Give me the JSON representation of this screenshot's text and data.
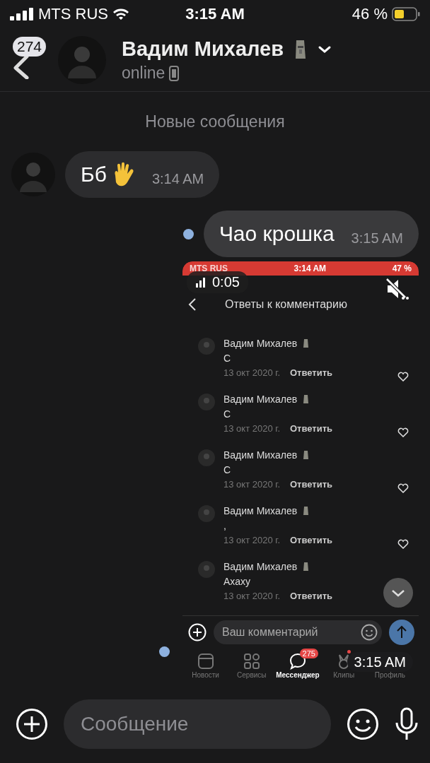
{
  "status_bar": {
    "carrier": "MTS RUS",
    "time": "3:15 AM",
    "battery": "46 %"
  },
  "header": {
    "back_count": "274",
    "name": "Вадим Михалев",
    "status": "online"
  },
  "divider": "Новые сообщения",
  "messages": [
    {
      "kind": "text",
      "incoming": true,
      "unread": false,
      "text": "Бб",
      "time": "3:14 AM"
    },
    {
      "kind": "text",
      "incoming": false,
      "unread": true,
      "text": "Чао крошка",
      "time": "3:15 AM"
    },
    {
      "kind": "video",
      "incoming": false,
      "unread": true,
      "duration": "0:05",
      "time": "3:15 AM",
      "muted": true
    }
  ],
  "video_screen": {
    "status_bar": {
      "carrier": "MTS RUS",
      "time": "3:14 AM",
      "battery": "47 %"
    },
    "title": "Ответы к комментарию",
    "comments": [
      {
        "author": "Вадим Михалев",
        "text": "С",
        "date": "13 окт 2020 г.",
        "reply": "Ответить"
      },
      {
        "author": "Вадим Михалев",
        "text": "С",
        "date": "13 окт 2020 г.",
        "reply": "Ответить"
      },
      {
        "author": "Вадим Михалев",
        "text": "С",
        "date": "13 окт 2020 г.",
        "reply": "Ответить"
      },
      {
        "author": "Вадим Михалев",
        "text": ",",
        "date": "13 окт 2020 г.",
        "reply": "Ответить"
      },
      {
        "author": "Вадим Михалев",
        "text": "Ахаху",
        "date": "13 окт 2020 г.",
        "reply": "Ответить"
      }
    ],
    "composer": {
      "placeholder": "Ваш комментарий"
    },
    "tabs": [
      {
        "kind": "news",
        "label": "Новости",
        "selected": false,
        "notification": false
      },
      {
        "kind": "services",
        "label": "Сервисы",
        "selected": false,
        "notification": false
      },
      {
        "kind": "messenger",
        "label": "Мессенджер",
        "selected": true,
        "notification": false,
        "badge": "275"
      },
      {
        "kind": "clips",
        "label": "Клипы",
        "selected": false,
        "notification": true
      },
      {
        "kind": "profile",
        "label": "Профиль",
        "selected": false,
        "notification": false
      }
    ]
  },
  "composer": {
    "placeholder": "Сообщение"
  }
}
